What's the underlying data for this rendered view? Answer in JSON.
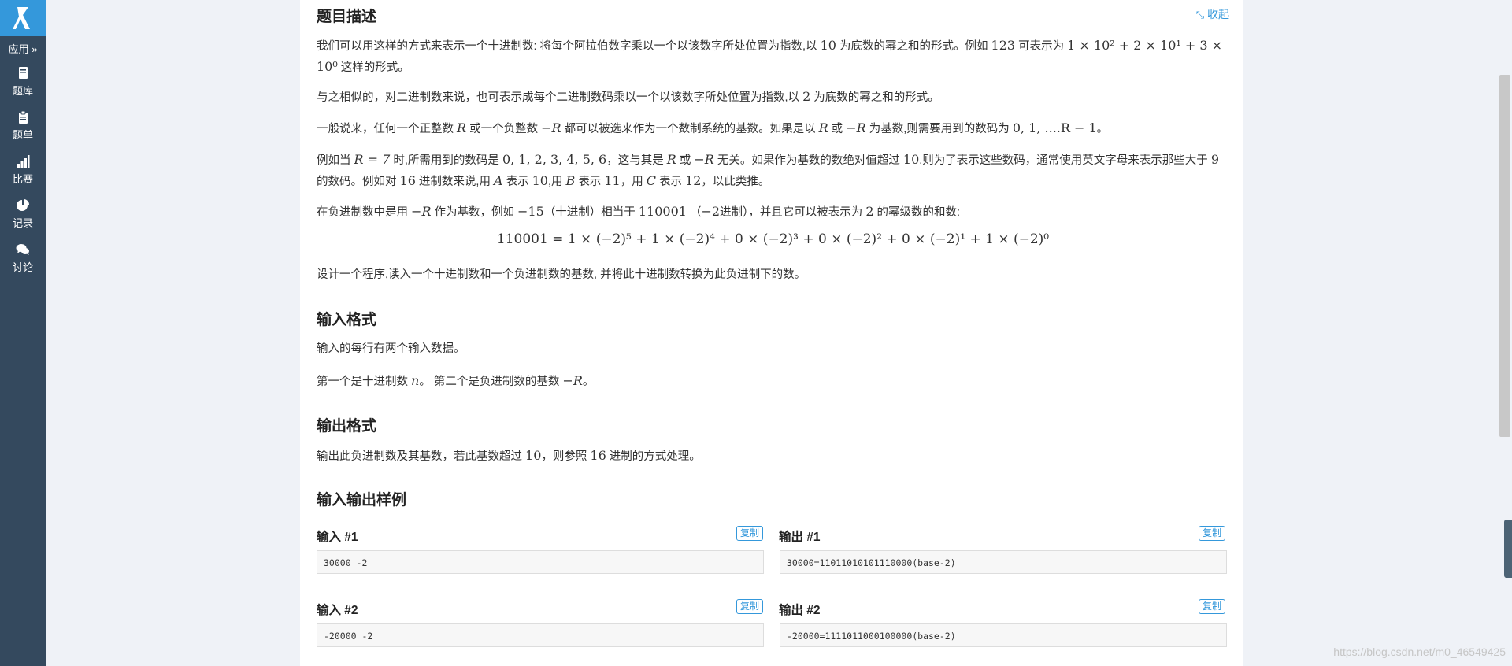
{
  "sidebar": {
    "apps_label": "应用 »",
    "items": [
      {
        "label": "题库",
        "icon": "book-icon"
      },
      {
        "label": "题单",
        "icon": "clipboard-icon"
      },
      {
        "label": "比赛",
        "icon": "bar-chart-icon"
      },
      {
        "label": "记录",
        "icon": "pie-chart-icon"
      },
      {
        "label": "讨论",
        "icon": "chat-icon"
      }
    ]
  },
  "problem": {
    "desc_title": "题目描述",
    "collapse_label": "收起",
    "para1_a": "我们可以用这样的方式来表示一个十进制数: 将每个阿拉伯数字乘以一个以该数字所处位置为指数,以 ",
    "para1_base": "10",
    "para1_b": " 为底数的幂之和的形式。例如 ",
    "para1_example": "123",
    "para1_c": " 可表示为 ",
    "para1_math": "1 × 10² + 2 × 10¹ + 3 × 10⁰",
    "para1_d": " 这样的形式。",
    "para2_a": "与之相似的，对二进制数来说，也可表示成每个二进制数码乘以一个以该数字所处位置为指数,以 ",
    "para2_base": "2",
    "para2_b": " 为底数的幂之和的形式。",
    "para3_a": "一般说来，任何一个正整数 ",
    "para3_R": "R",
    "para3_b": " 或一个负整数 ",
    "para3_negR": "−R",
    "para3_c": " 都可以被选来作为一个数制系统的基数。如果是以 ",
    "para3_d": " 或 ",
    "para3_e": " 为基数,则需要用到的数码为 ",
    "para3_digits": "0, 1, ....R − 1",
    "para3_f": "。",
    "para4_a": "例如当 ",
    "para4_eq": "R = 7",
    "para4_b": " 时,所需用到的数码是 ",
    "para4_digits": "0, 1, 2, 3, 4, 5, 6",
    "para4_c": "，这与其是 ",
    "para4_d": " 或 ",
    "para4_e": " 无关。如果作为基数的数绝对值超过 ",
    "para4_ten": "10",
    "para4_f": ",则为了表示这些数码，通常使用英文字母来表示那些大于 ",
    "para4_nine": "9",
    "para4_g": " 的数码。例如对 ",
    "para4_sixteen": "16",
    "para4_h": " 进制数来说,用 ",
    "para4_A": "A",
    "para4_i": " 表示 ",
    "para4_j": ",用 ",
    "para4_B": "B",
    "para4_eleven": "11",
    "para4_k": "，用 ",
    "para4_C": "C",
    "para4_twelve": "12",
    "para4_l": "，以此类推。",
    "para5_a": "在负进制数中是用 ",
    "para5_b": " 作为基数，例如 ",
    "para5_neg15": "−15",
    "para5_c": "（十进制）相当于 ",
    "para5_num": "110001",
    "para5_d": " （",
    "para5_neg2": "−2",
    "para5_e": "进制），并且它可以被表示为 ",
    "para5_two": "2",
    "para5_f": " 的幂级数的和数:",
    "formula": "110001 = 1 × (−2)⁵ + 1 × (−2)⁴ + 0 × (−2)³ + 0 × (−2)² + 0 × (−2)¹ + 1 × (−2)⁰",
    "para6": "设计一个程序,读入一个十进制数和一个负进制数的基数, 并将此十进制数转换为此负进制下的数。",
    "input_title": "输入格式",
    "input_p1": "输入的每行有两个输入数据。",
    "input_p2_a": "第一个是十进制数 ",
    "input_p2_n": "n",
    "input_p2_b": "。 第二个是负进制数的基数 ",
    "input_p2_c": "。",
    "output_title": "输出格式",
    "output_p_a": "输出此负进制数及其基数，若此基数超过 ",
    "output_p_b": "，则参照 ",
    "output_p_c": " 进制的方式处理。",
    "samples_title": "输入输出样例",
    "copy_label": "复制",
    "samples": [
      {
        "in_label": "输入 #1",
        "in": "30000 -2",
        "out_label": "输出 #1",
        "out": "30000=11011010101110000(base-2)"
      },
      {
        "in_label": "输入 #2",
        "in": "-20000 -2",
        "out_label": "输出 #2",
        "out": "-20000=1111011000100000(base-2)"
      }
    ]
  },
  "watermark": "https://blog.csdn.net/m0_46549425",
  "colors": {
    "sidebar": "#34495e",
    "accent": "#3498db",
    "logo_bg": "#3498db"
  }
}
